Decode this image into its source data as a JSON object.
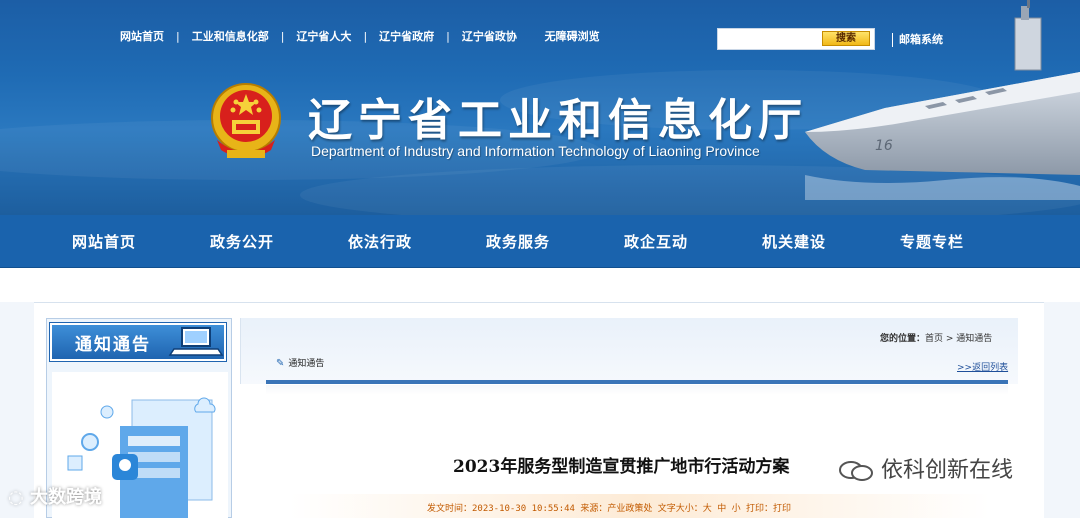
{
  "header": {
    "top_links": [
      "网站首页",
      "工业和信息化部",
      "辽宁省人大",
      "辽宁省政府",
      "辽宁省政协",
      "无障碍浏览"
    ],
    "search_button": "搜索",
    "mail_link": "邮箱系统",
    "site_title": "辽宁省工业和信息化厅",
    "site_subtitle": "Department of Industry and Information Technology of Liaoning Province"
  },
  "main_nav": [
    "网站首页",
    "政务公开",
    "依法行政",
    "政务服务",
    "政企互动",
    "机关建设",
    "专题专栏"
  ],
  "sidebar": {
    "title": "通知通告"
  },
  "panel": {
    "breadcrumb_label": "您的位置：",
    "breadcrumb_path": "首页 > 通知通告",
    "section_tag": "通知通告",
    "back_link": ">>返回列表"
  },
  "article": {
    "title": "2023年服务型制造宣贯推广地市行活动方案",
    "meta": "发文时间：2023-10-30 10:55:44 来源：产业政策处 文字大小：大 中 小    打印：打印"
  },
  "watermarks": {
    "left": "大数跨境",
    "right": "依科创新在线"
  },
  "colors": {
    "banner_blue": "#1f6bb4",
    "nav_blue": "#1a63ad",
    "accent_orange": "#c25a00",
    "button_yellow": "#f1b818"
  }
}
